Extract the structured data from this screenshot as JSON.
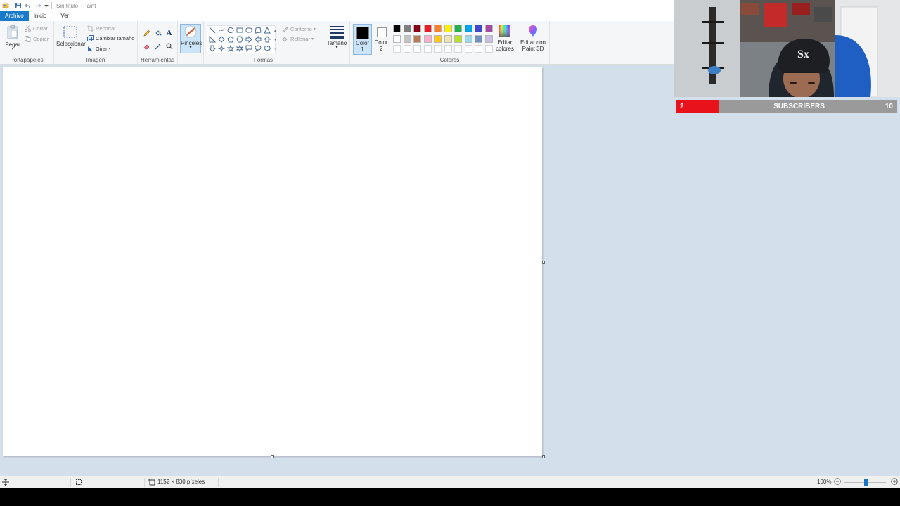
{
  "window": {
    "title": "Sin título - Paint"
  },
  "tabs": {
    "file": "Archivo",
    "home": "Inicio",
    "view": "Ver"
  },
  "clipboard": {
    "paste": "Pegar",
    "cut": "Cortar",
    "copy": "Copiar",
    "label": "Portapapeles"
  },
  "image": {
    "select": "Seleccionar",
    "crop": "Recortar",
    "resize": "Cambiar tamaño",
    "rotate": "Girar",
    "label": "Imagen"
  },
  "tools": {
    "label": "Herramientas",
    "brushes": "Pinceles"
  },
  "shapes": {
    "outline": "Contorno",
    "fill": "Rellenar",
    "label": "Formas"
  },
  "size": {
    "label": "Tamaño"
  },
  "colors": {
    "color1": "Color 1",
    "color2": "Color 2",
    "edit": "Editar colores",
    "paint3d": "Editar con Paint 3D",
    "label": "Colores",
    "palette_row1": [
      "#000000",
      "#7f7f7f",
      "#880015",
      "#ed1c24",
      "#ff7f27",
      "#fff200",
      "#22b14c",
      "#00a2e8",
      "#3f48cc",
      "#a349a4"
    ],
    "palette_row2": [
      "#ffffff",
      "#c3c3c3",
      "#b97a57",
      "#ffaec9",
      "#ffc90e",
      "#efe4b0",
      "#b5e61d",
      "#99d9ea",
      "#7092be",
      "#c8bfe7"
    ]
  },
  "status": {
    "dimensions": "1152 × 830 píxeles",
    "zoom": "100%"
  },
  "overlay": {
    "subscriber_count": "2",
    "subscriber_label": "SUBSCRIBERS",
    "subscriber_goal": "10"
  }
}
